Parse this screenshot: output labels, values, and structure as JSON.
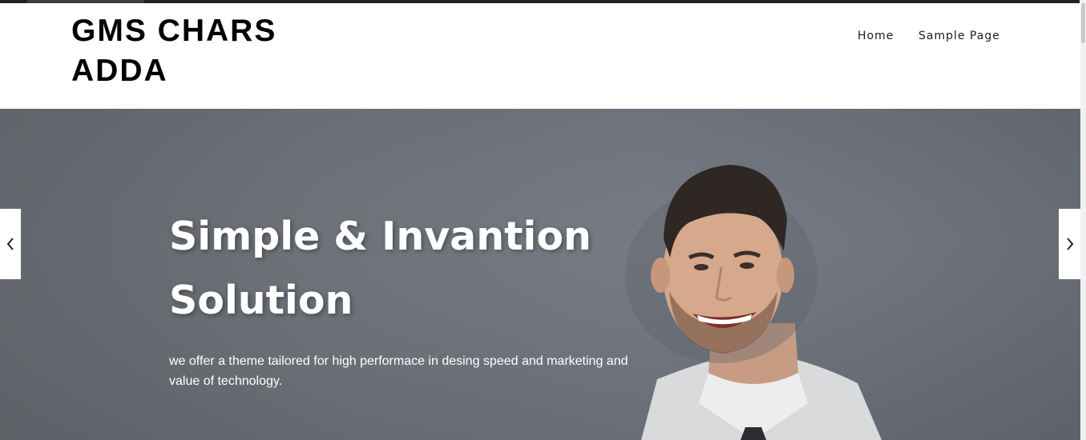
{
  "site": {
    "title": "GMS CHARS ADDA"
  },
  "nav": {
    "items": [
      "Home",
      "Sample Page"
    ]
  },
  "hero": {
    "title_line1": "Simple & Invantion",
    "title_line2": "Solution",
    "description": "we offer a theme tailored for high performace in desing speed and marketing and value of technology."
  },
  "slider": {
    "prev_icon": "chevron-left-icon",
    "next_icon": "chevron-right-icon"
  },
  "colors": {
    "header_bg": "#ffffff",
    "hero_overlay": "#6f747b",
    "title_text": "#000000",
    "hero_text": "#ffffff"
  }
}
